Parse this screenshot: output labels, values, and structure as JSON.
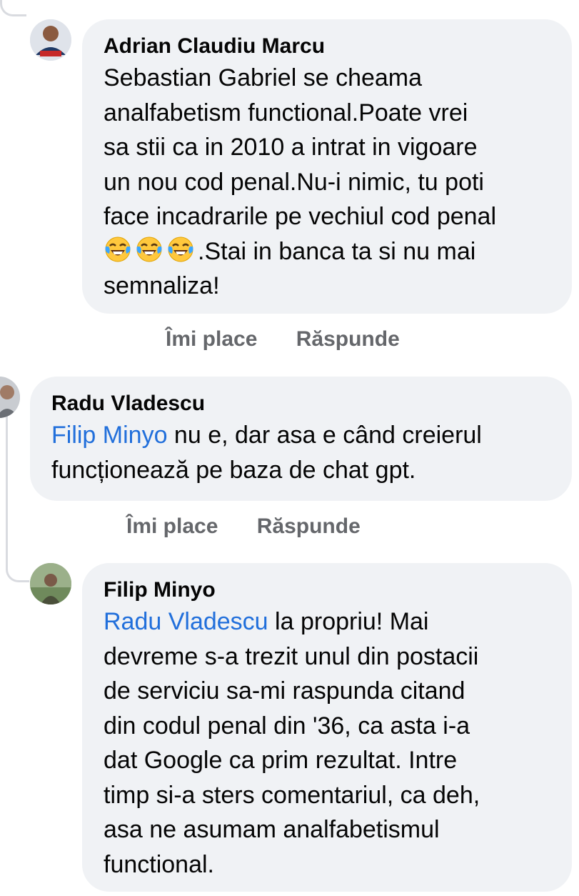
{
  "comments": [
    {
      "author": "Adrian Claudiu Marcu",
      "lines": [
        "Sebastian Gabriel se cheama",
        "analfabetism functional.Poate vrei",
        "sa stii ca in 2010 a intrat in vigoare",
        "un nou cod penal.Nu-i nimic, tu poti",
        "face incadrarile pe vechiul cod penal"
      ],
      "emoji_line_text": ".Stai in banca ta si nu mai",
      "last_line": "semnaliza!",
      "emoji": "face-with-tears-of-joy-icon",
      "like_label": "Îmi place",
      "reply_label": "Răspunde"
    },
    {
      "author": "Radu Vladescu",
      "mention": "Filip Minyo",
      "line1_rest": " nu e, dar asa e când creierul",
      "line2": "funcționează pe baza de chat gpt.",
      "like_label": "Îmi place",
      "reply_label": "Răspunde"
    },
    {
      "author": "Filip Minyo",
      "mention": "Radu Vladescu",
      "line1_rest": " la propriu! Mai",
      "lines": [
        "devreme s-a trezit unul din postacii",
        "de serviciu sa-mi raspunda citand",
        "din codul penal din '36, ca asta i-a",
        "dat Google ca prim rezultat. Intre",
        "timp si-a sters comentariul, ca deh,",
        "asa ne asumam analfabetismul",
        "functional."
      ]
    }
  ],
  "colors": {
    "bubble": "#f0f2f5",
    "mention": "#216fdb",
    "action": "#65676b"
  }
}
